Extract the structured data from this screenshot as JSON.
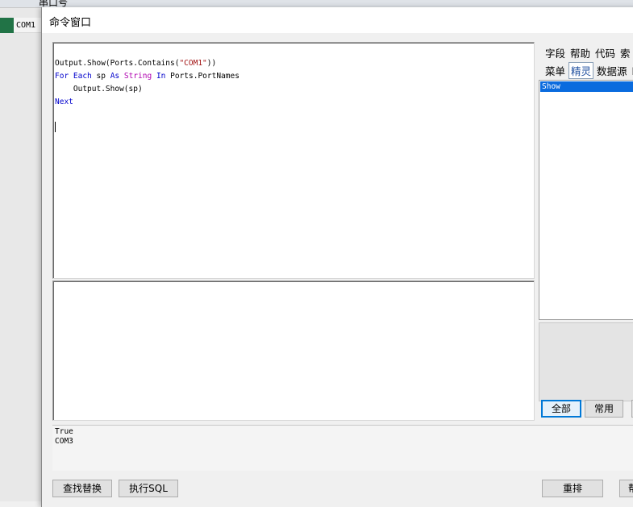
{
  "background": {
    "column_title": "串口号",
    "cell_value": "COM1"
  },
  "dialog": {
    "title": "命令窗口"
  },
  "editor": {
    "lines": [
      "Output.Show(Ports.Contains(\"COM1\"))",
      "For Each sp As String In Ports.PortNames",
      "    Output.Show(sp)",
      "Next"
    ]
  },
  "output": {
    "text": "True\nCOM3"
  },
  "side_tabs": {
    "row1": [
      "字段",
      "帮助",
      "代码",
      "索"
    ],
    "row2": [
      "菜单",
      "精灵",
      "数据源",
      "l"
    ],
    "active": "精灵"
  },
  "wizard_list": {
    "items": [
      "Show"
    ],
    "selected": "Show"
  },
  "filter_buttons": {
    "all": "全部",
    "common": "常用"
  },
  "bottom_buttons": {
    "find_replace": "查找替换",
    "exec_sql": "执行SQL",
    "rearrange": "重排",
    "help": "帮"
  },
  "colors": {
    "keyword": "#0000cc",
    "type": "#b000b0",
    "string": "#a31515",
    "selection": "#0a6bde",
    "grid_row_marker": "#217346"
  }
}
